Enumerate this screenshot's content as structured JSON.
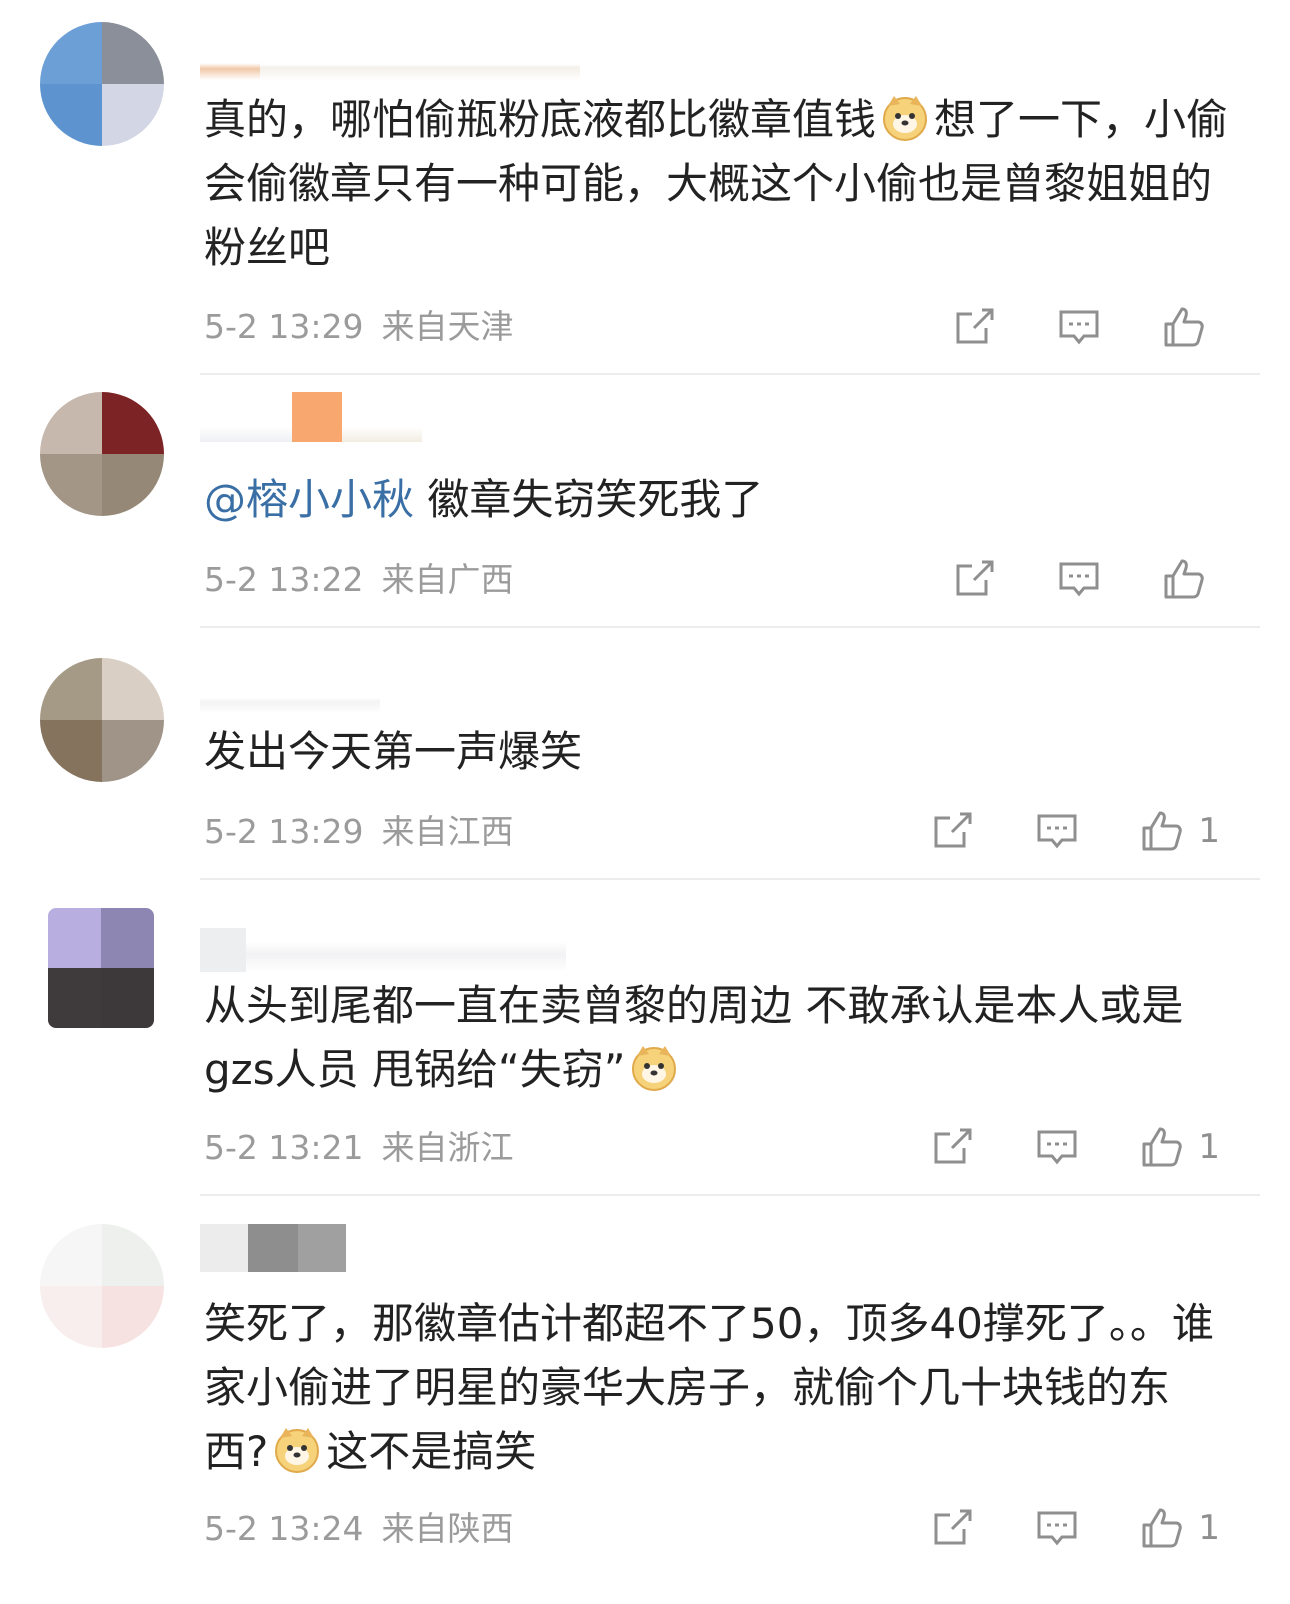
{
  "comments": [
    {
      "text_a": "真的，哪怕偷瓶粉底液都比徽章值钱",
      "text_b": "想了一下，小偷会偷徽章只有一种可能，大概这个小偷也是曾黎姐姐的粉丝吧",
      "time": "5-2 13:29",
      "location": "来自天津",
      "likes": ""
    },
    {
      "mention": "@榕小小秋",
      "text_a": " 徽章失窃笑死我了",
      "time": "5-2 13:22",
      "location": "来自广西",
      "likes": ""
    },
    {
      "text_a": "发出今天第一声爆笑",
      "time": "5-2 13:29",
      "location": "来自江西",
      "likes": "1"
    },
    {
      "text_a": "从头到尾都一直在卖曾黎的周边 不敢承认是本人或是gzs人员 甩锅给“失窃”",
      "time": "5-2 13:21",
      "location": "来自浙江",
      "likes": "1"
    },
    {
      "text_a": "笑死了，那徽章估计都超不了50，顶多40撑死了。。谁家小偷进了明星的豪华大房子，就偷个几十块钱的东西?",
      "text_b": "这不是搞笑",
      "time": "5-2 13:24",
      "location": "来自陕西",
      "likes": "1"
    }
  ],
  "icons": {
    "share": "share-icon",
    "reply": "comment-icon",
    "like": "thumbs-up-icon",
    "emoji": "doge-emoji-icon"
  },
  "colors": {
    "mention": "#3a6fa6",
    "meta": "#9b9b9b",
    "icon": "#8f8f8f"
  }
}
